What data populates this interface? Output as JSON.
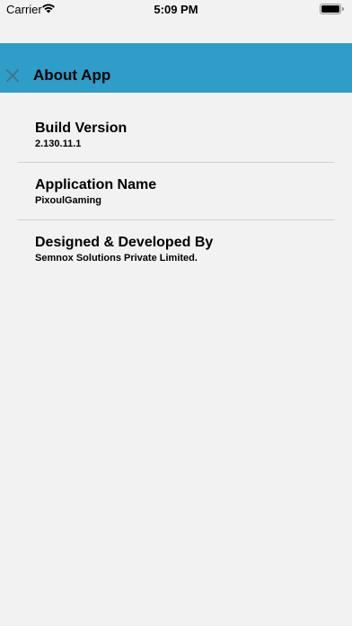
{
  "status_bar": {
    "carrier": "Carrier",
    "time": "5:09 PM"
  },
  "header": {
    "title": "About App",
    "close_icon": "close-icon",
    "background_color": "#2e9dc8"
  },
  "about_items": [
    {
      "label": "Build Version",
      "value": "2.130.11.1"
    },
    {
      "label": "Application Name",
      "value": "PixoulGaming"
    },
    {
      "label": "Designed & Developed By",
      "value": "Semnox Solutions Private Limited."
    }
  ]
}
